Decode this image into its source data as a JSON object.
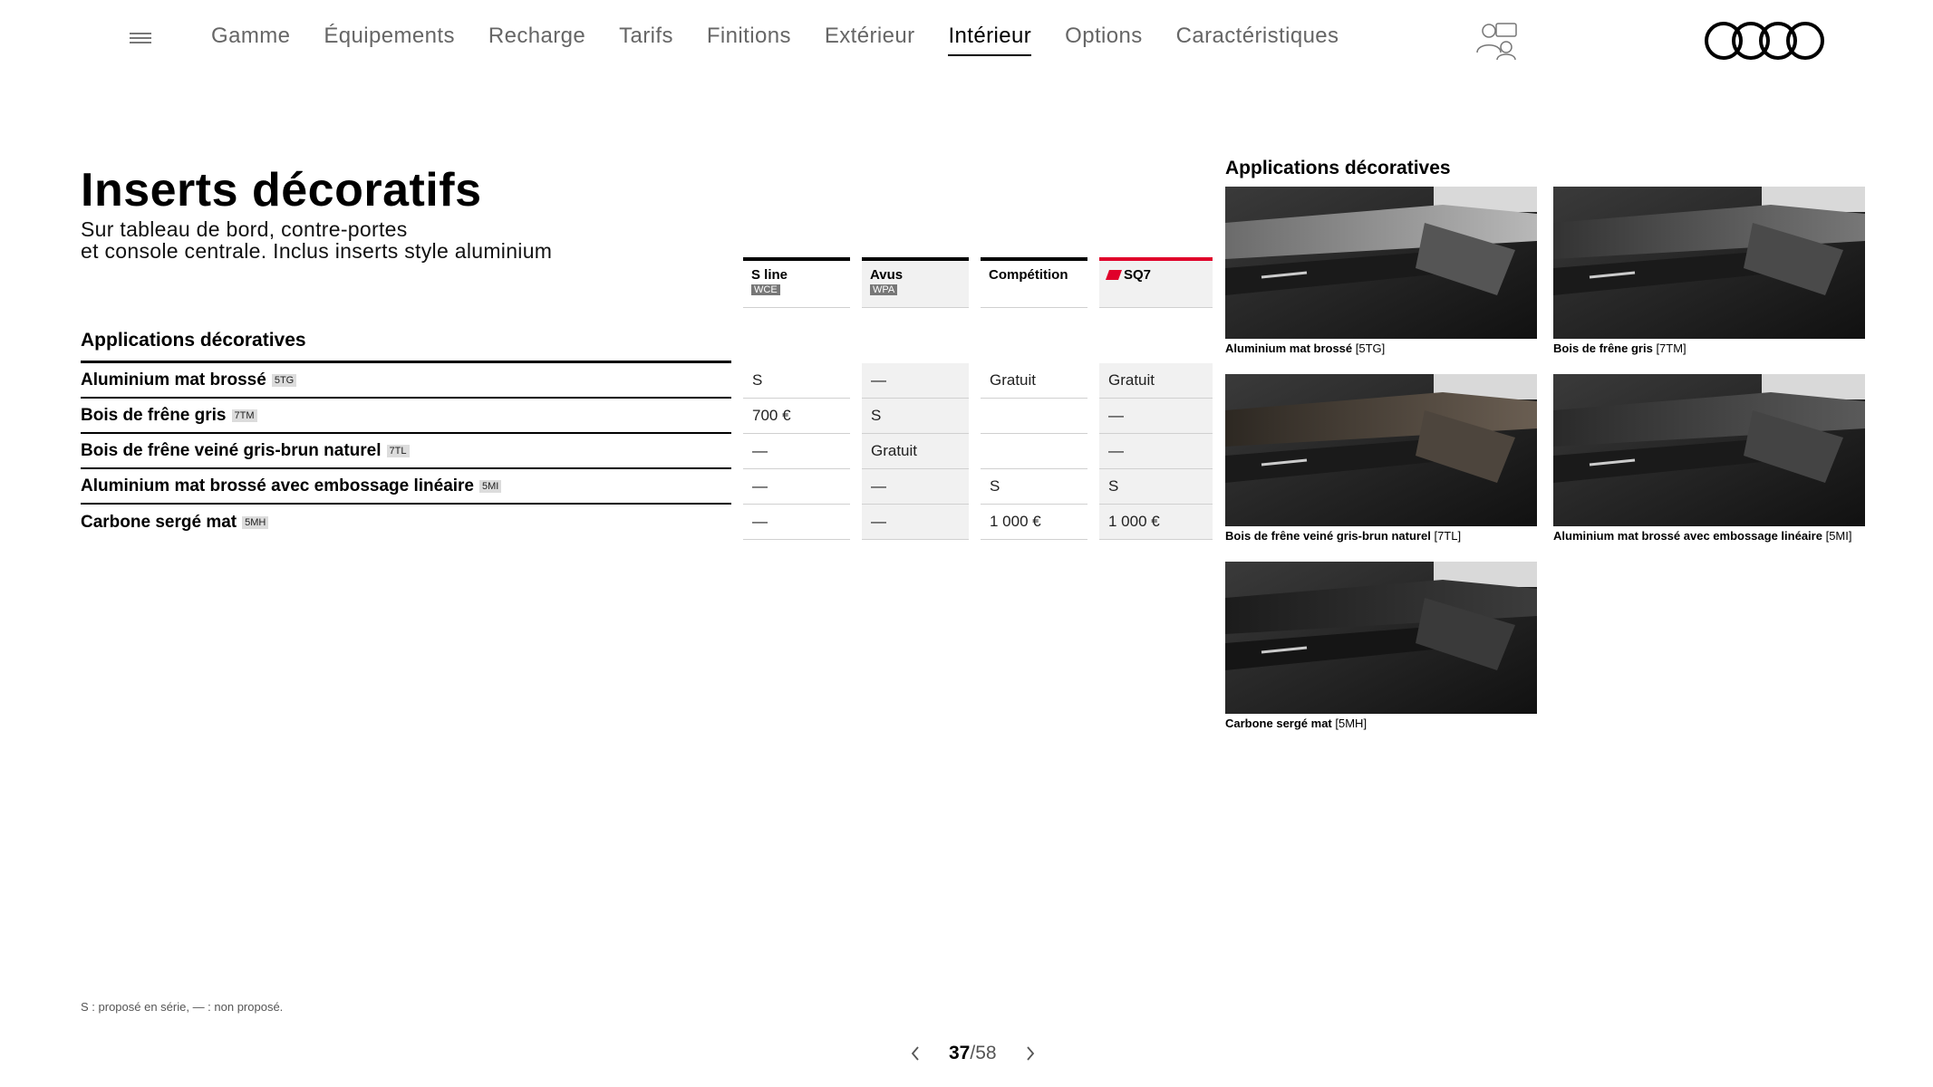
{
  "nav": {
    "items": [
      "Gamme",
      "Équipements",
      "Recharge",
      "Tarifs",
      "Finitions",
      "Extérieur",
      "Intérieur",
      "Options",
      "Caractéristiques"
    ],
    "active": "Intérieur",
    "menu_icon": "hamburger-menu-icon",
    "assist_icon": "advisor-chat-icon",
    "logo": "four-rings-logo"
  },
  "page": {
    "title": "Inserts décoratifs",
    "subtitle_line1": "Sur tableau de bord, contre-portes",
    "subtitle_line2": "et console centrale. Inclus inserts style aluminium"
  },
  "table": {
    "section_label": "Applications décoratives",
    "columns": [
      {
        "name": "S line",
        "code": "WCE"
      },
      {
        "name": "Avus",
        "code": "WPA"
      },
      {
        "name": "Compétition",
        "code": ""
      },
      {
        "name": "SQ7",
        "code": ""
      }
    ],
    "rows": [
      {
        "label": "Aluminium mat brossé",
        "code": "5TG",
        "values": [
          "S",
          "—",
          "Gratuit",
          "Gratuit"
        ]
      },
      {
        "label": "Bois de frêne gris",
        "code": "7TM",
        "values": [
          "700 €",
          "S",
          "",
          "—"
        ]
      },
      {
        "label": "Bois de frêne veiné gris-brun naturel",
        "code": "7TL",
        "values": [
          "—",
          "Gratuit",
          "",
          "—"
        ]
      },
      {
        "label": "Aluminium mat brossé avec embossage linéaire",
        "code": "5MI",
        "values": [
          "—",
          "—",
          "S",
          "S"
        ]
      },
      {
        "label": "Carbone sergé mat",
        "code": "5MH",
        "values": [
          "—",
          "—",
          "1 000 €",
          "1 000 €"
        ]
      }
    ]
  },
  "gallery": {
    "title": "Applications décoratives",
    "items": [
      {
        "name": "Aluminium mat brossé",
        "code": "[5TG]"
      },
      {
        "name": "Bois de frêne gris",
        "code": "[7TM]"
      },
      {
        "name": "Bois de frêne veiné gris-brun naturel",
        "code": "[7TL]"
      },
      {
        "name": "Aluminium mat brossé avec embossage linéaire",
        "code": "[5MI]"
      },
      {
        "name": "Carbone sergé mat",
        "code": "[5MH]"
      }
    ]
  },
  "footer": {
    "legend": "S : proposé en série, — : non proposé.",
    "page_current": "37",
    "page_total": "/58"
  },
  "colors": {
    "accent_red": "#e0002a",
    "text": "#000000",
    "muted": "#666666",
    "cell_shade": "#f1f1f1"
  }
}
